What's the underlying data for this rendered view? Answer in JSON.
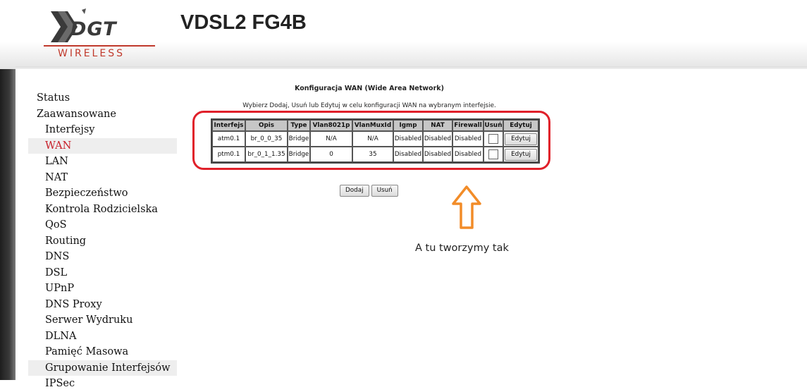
{
  "header": {
    "logo_main": "DGT",
    "logo_sub": "WIRELESS",
    "product_name": "VDSL2 FG4B"
  },
  "sidebar": {
    "items": [
      {
        "label": "Status",
        "level": 0
      },
      {
        "label": "Zaawansowane",
        "level": 0
      },
      {
        "label": "Interfejsy",
        "level": 1
      },
      {
        "label": "WAN",
        "level": 1,
        "active": true
      },
      {
        "label": "LAN",
        "level": 1
      },
      {
        "label": "NAT",
        "level": 1
      },
      {
        "label": "Bezpieczeństwo",
        "level": 1
      },
      {
        "label": "Kontrola Rodzicielska",
        "level": 1
      },
      {
        "label": "QoS",
        "level": 1
      },
      {
        "label": "Routing",
        "level": 1
      },
      {
        "label": "DNS",
        "level": 1
      },
      {
        "label": "DSL",
        "level": 1
      },
      {
        "label": "UPnP",
        "level": 1
      },
      {
        "label": "DNS Proxy",
        "level": 1
      },
      {
        "label": "Serwer Wydruku",
        "level": 1
      },
      {
        "label": "DLNA",
        "level": 1
      },
      {
        "label": "Pamięć Masowa",
        "level": 1
      },
      {
        "label": "Grupowanie Interfejsów",
        "level": 1,
        "shaded": true
      },
      {
        "label": "IPSec",
        "level": 1
      }
    ]
  },
  "content": {
    "title": "Konfiguracja WAN (Wide Area Network)",
    "description": "Wybierz Dodaj, Usuń lub Edytuj w celu konfiguracji WAN na wybranym interfejsie.",
    "table": {
      "headers": [
        "Interfejs",
        "Opis",
        "Type",
        "Vlan8021p",
        "VlanMuxId",
        "Igmp",
        "NAT",
        "Firewall",
        "Usuń",
        "Edytuj"
      ],
      "rows": [
        {
          "interfejs": "atm0.1",
          "opis": "br_0_0_35",
          "type": "Bridge",
          "vlan8021p": "N/A",
          "vlanmuxid": "N/A",
          "igmp": "Disabled",
          "nat": "Disabled",
          "firewall": "Disabled",
          "edit_label": "Edytuj"
        },
        {
          "interfejs": "ptm0.1",
          "opis": "br_0_1_1.35",
          "type": "Bridge",
          "vlan8021p": "0",
          "vlanmuxid": "35",
          "igmp": "Disabled",
          "nat": "Disabled",
          "firewall": "Disabled",
          "edit_label": "Edytuj"
        }
      ]
    },
    "add_label": "Dodaj",
    "remove_label": "Usuń"
  },
  "annotation": {
    "text": "A tu tworzymy tak",
    "highlight_color": "#e0202a",
    "arrow_color": "#f28c28"
  }
}
